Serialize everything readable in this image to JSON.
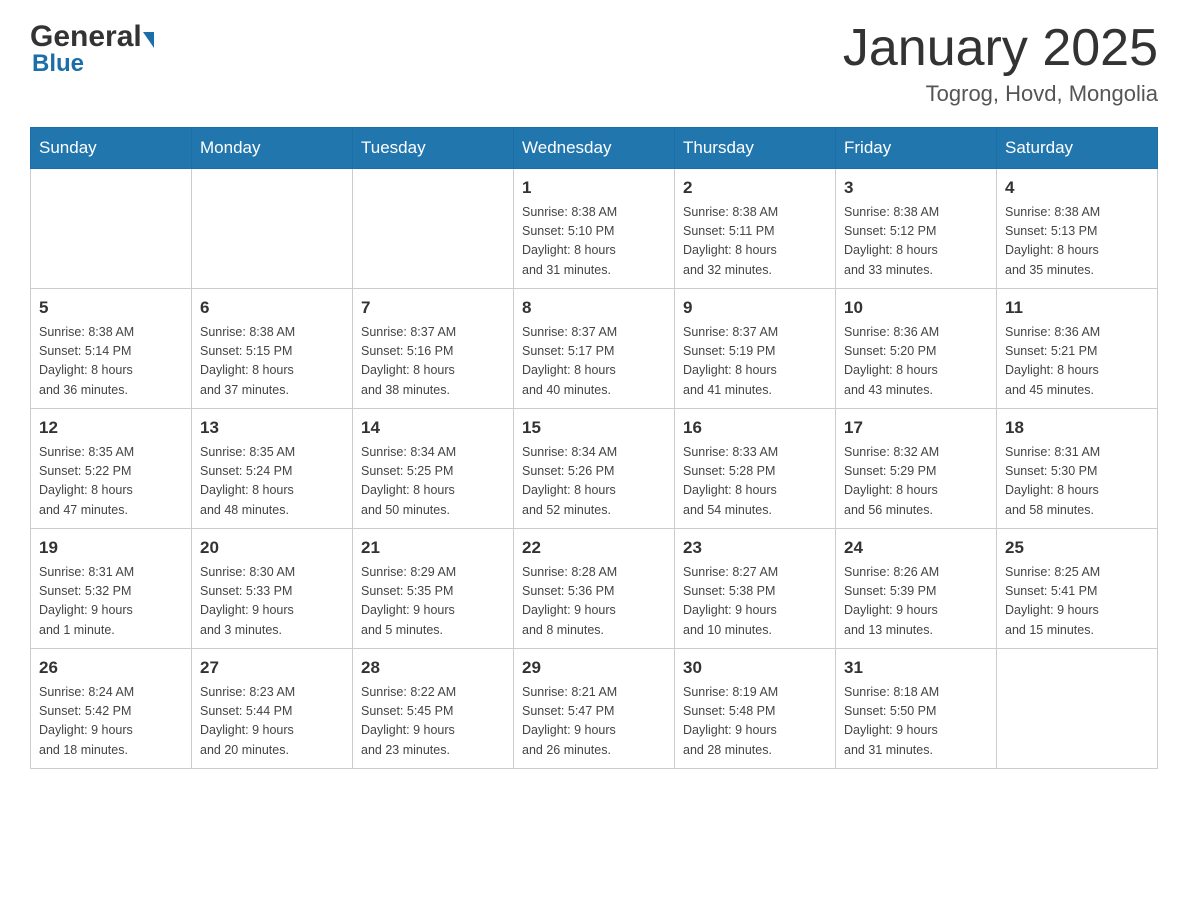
{
  "header": {
    "logo_general": "General",
    "logo_blue": "Blue",
    "month_year": "January 2025",
    "location": "Togrog, Hovd, Mongolia"
  },
  "days_of_week": [
    "Sunday",
    "Monday",
    "Tuesday",
    "Wednesday",
    "Thursday",
    "Friday",
    "Saturday"
  ],
  "weeks": [
    [
      {
        "day": "",
        "info": ""
      },
      {
        "day": "",
        "info": ""
      },
      {
        "day": "",
        "info": ""
      },
      {
        "day": "1",
        "info": "Sunrise: 8:38 AM\nSunset: 5:10 PM\nDaylight: 8 hours\nand 31 minutes."
      },
      {
        "day": "2",
        "info": "Sunrise: 8:38 AM\nSunset: 5:11 PM\nDaylight: 8 hours\nand 32 minutes."
      },
      {
        "day": "3",
        "info": "Sunrise: 8:38 AM\nSunset: 5:12 PM\nDaylight: 8 hours\nand 33 minutes."
      },
      {
        "day": "4",
        "info": "Sunrise: 8:38 AM\nSunset: 5:13 PM\nDaylight: 8 hours\nand 35 minutes."
      }
    ],
    [
      {
        "day": "5",
        "info": "Sunrise: 8:38 AM\nSunset: 5:14 PM\nDaylight: 8 hours\nand 36 minutes."
      },
      {
        "day": "6",
        "info": "Sunrise: 8:38 AM\nSunset: 5:15 PM\nDaylight: 8 hours\nand 37 minutes."
      },
      {
        "day": "7",
        "info": "Sunrise: 8:37 AM\nSunset: 5:16 PM\nDaylight: 8 hours\nand 38 minutes."
      },
      {
        "day": "8",
        "info": "Sunrise: 8:37 AM\nSunset: 5:17 PM\nDaylight: 8 hours\nand 40 minutes."
      },
      {
        "day": "9",
        "info": "Sunrise: 8:37 AM\nSunset: 5:19 PM\nDaylight: 8 hours\nand 41 minutes."
      },
      {
        "day": "10",
        "info": "Sunrise: 8:36 AM\nSunset: 5:20 PM\nDaylight: 8 hours\nand 43 minutes."
      },
      {
        "day": "11",
        "info": "Sunrise: 8:36 AM\nSunset: 5:21 PM\nDaylight: 8 hours\nand 45 minutes."
      }
    ],
    [
      {
        "day": "12",
        "info": "Sunrise: 8:35 AM\nSunset: 5:22 PM\nDaylight: 8 hours\nand 47 minutes."
      },
      {
        "day": "13",
        "info": "Sunrise: 8:35 AM\nSunset: 5:24 PM\nDaylight: 8 hours\nand 48 minutes."
      },
      {
        "day": "14",
        "info": "Sunrise: 8:34 AM\nSunset: 5:25 PM\nDaylight: 8 hours\nand 50 minutes."
      },
      {
        "day": "15",
        "info": "Sunrise: 8:34 AM\nSunset: 5:26 PM\nDaylight: 8 hours\nand 52 minutes."
      },
      {
        "day": "16",
        "info": "Sunrise: 8:33 AM\nSunset: 5:28 PM\nDaylight: 8 hours\nand 54 minutes."
      },
      {
        "day": "17",
        "info": "Sunrise: 8:32 AM\nSunset: 5:29 PM\nDaylight: 8 hours\nand 56 minutes."
      },
      {
        "day": "18",
        "info": "Sunrise: 8:31 AM\nSunset: 5:30 PM\nDaylight: 8 hours\nand 58 minutes."
      }
    ],
    [
      {
        "day": "19",
        "info": "Sunrise: 8:31 AM\nSunset: 5:32 PM\nDaylight: 9 hours\nand 1 minute."
      },
      {
        "day": "20",
        "info": "Sunrise: 8:30 AM\nSunset: 5:33 PM\nDaylight: 9 hours\nand 3 minutes."
      },
      {
        "day": "21",
        "info": "Sunrise: 8:29 AM\nSunset: 5:35 PM\nDaylight: 9 hours\nand 5 minutes."
      },
      {
        "day": "22",
        "info": "Sunrise: 8:28 AM\nSunset: 5:36 PM\nDaylight: 9 hours\nand 8 minutes."
      },
      {
        "day": "23",
        "info": "Sunrise: 8:27 AM\nSunset: 5:38 PM\nDaylight: 9 hours\nand 10 minutes."
      },
      {
        "day": "24",
        "info": "Sunrise: 8:26 AM\nSunset: 5:39 PM\nDaylight: 9 hours\nand 13 minutes."
      },
      {
        "day": "25",
        "info": "Sunrise: 8:25 AM\nSunset: 5:41 PM\nDaylight: 9 hours\nand 15 minutes."
      }
    ],
    [
      {
        "day": "26",
        "info": "Sunrise: 8:24 AM\nSunset: 5:42 PM\nDaylight: 9 hours\nand 18 minutes."
      },
      {
        "day": "27",
        "info": "Sunrise: 8:23 AM\nSunset: 5:44 PM\nDaylight: 9 hours\nand 20 minutes."
      },
      {
        "day": "28",
        "info": "Sunrise: 8:22 AM\nSunset: 5:45 PM\nDaylight: 9 hours\nand 23 minutes."
      },
      {
        "day": "29",
        "info": "Sunrise: 8:21 AM\nSunset: 5:47 PM\nDaylight: 9 hours\nand 26 minutes."
      },
      {
        "day": "30",
        "info": "Sunrise: 8:19 AM\nSunset: 5:48 PM\nDaylight: 9 hours\nand 28 minutes."
      },
      {
        "day": "31",
        "info": "Sunrise: 8:18 AM\nSunset: 5:50 PM\nDaylight: 9 hours\nand 31 minutes."
      },
      {
        "day": "",
        "info": ""
      }
    ]
  ]
}
